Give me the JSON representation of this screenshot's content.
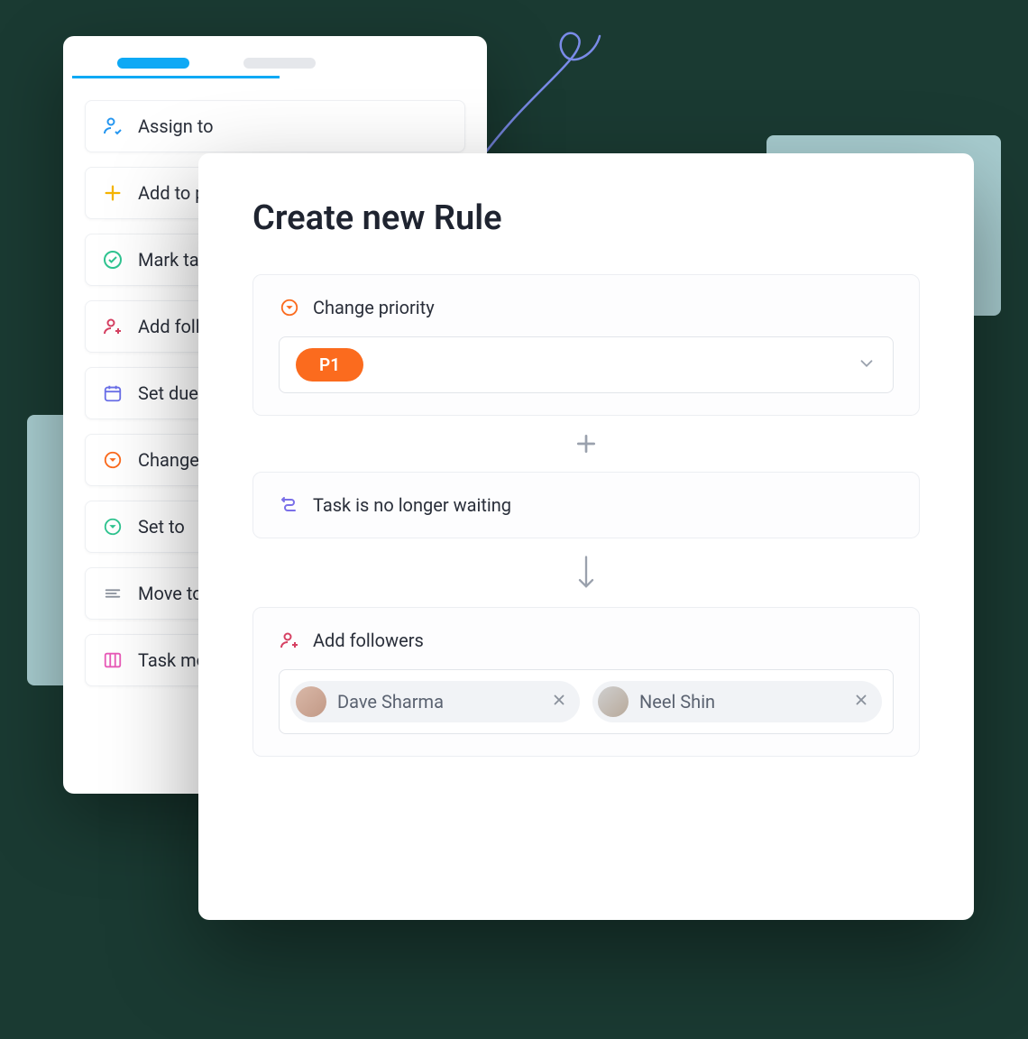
{
  "tabs": {
    "active": true
  },
  "actions": [
    {
      "label": "Assign to",
      "icon": "assign"
    },
    {
      "label": "Add to p",
      "icon": "plus"
    },
    {
      "label": "Mark tas",
      "icon": "check"
    },
    {
      "label": "Add follo",
      "icon": "follower"
    },
    {
      "label": "Set due d",
      "icon": "calendar"
    },
    {
      "label": "Change p",
      "icon": "priority"
    },
    {
      "label": "Set to",
      "icon": "setto"
    },
    {
      "label": "Move to",
      "icon": "moveto"
    },
    {
      "label": "Task mov",
      "icon": "board"
    }
  ],
  "front": {
    "title": "Create new Rule",
    "priority": {
      "label": "Change priority",
      "value": "P1"
    },
    "waiting": {
      "label": "Task is no longer waiting"
    },
    "followers": {
      "label": "Add followers",
      "chips": [
        {
          "name": "Dave Sharma"
        },
        {
          "name": "Neel Shin"
        }
      ]
    }
  }
}
